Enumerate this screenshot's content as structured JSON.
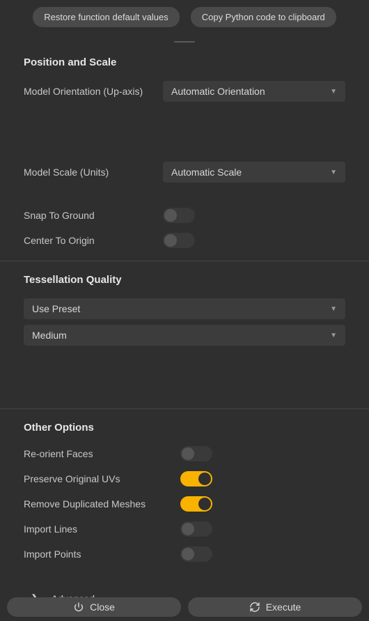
{
  "topbar": {
    "restore_label": "Restore function default values",
    "copy_label": "Copy Python code to clipboard"
  },
  "sections": {
    "position_scale": {
      "title": "Position and Scale",
      "model_orientation": {
        "label": "Model Orientation (Up-axis)",
        "value": "Automatic Orientation"
      },
      "model_scale": {
        "label": "Model Scale (Units)",
        "value": "Automatic Scale"
      },
      "snap_ground": {
        "label": "Snap To Ground",
        "on": false
      },
      "center_origin": {
        "label": "Center To Origin",
        "on": false
      }
    },
    "tessellation": {
      "title": "Tessellation Quality",
      "preset_mode": "Use Preset",
      "preset_value": "Medium"
    },
    "other": {
      "title": "Other Options",
      "reorient_faces": {
        "label": "Re-orient Faces",
        "on": false
      },
      "preserve_uvs": {
        "label": "Preserve Original UVs",
        "on": true
      },
      "remove_dup": {
        "label": "Remove Duplicated Meshes",
        "on": true
      },
      "import_lines": {
        "label": "Import Lines",
        "on": false
      },
      "import_points": {
        "label": "Import Points",
        "on": false
      }
    },
    "advanced": {
      "label": "Advanced"
    }
  },
  "footer": {
    "close_label": "Close",
    "execute_label": "Execute"
  }
}
